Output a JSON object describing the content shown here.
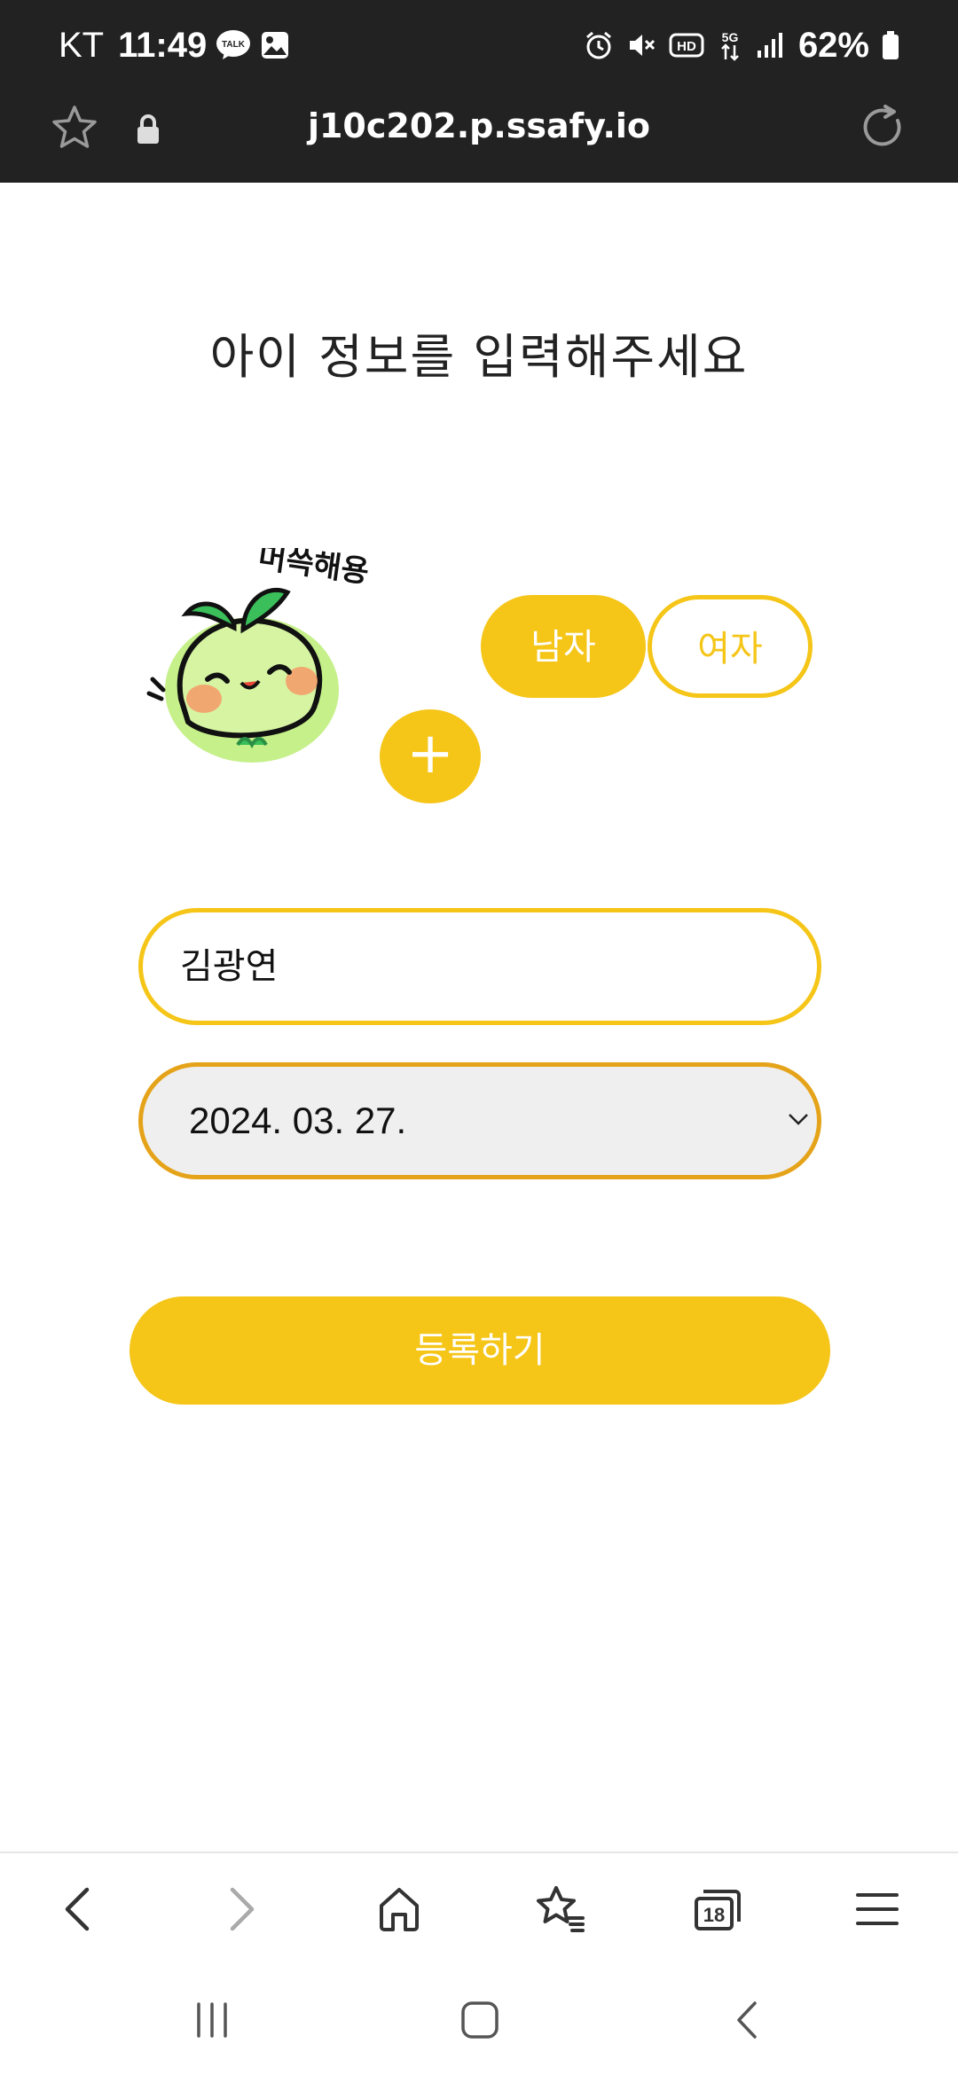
{
  "status_bar": {
    "carrier": "KT",
    "time": "11:49",
    "talk_label": "TALK",
    "hd_label": "HD",
    "network_label": "5G",
    "battery": "62%"
  },
  "browser": {
    "url": "j10c202.p.ssafy.io"
  },
  "form": {
    "title": "아이 정보를 입력해주세요",
    "gender": {
      "male": "남자",
      "female": "여자",
      "selected": "남자"
    },
    "add_photo_symbol": "+",
    "name_value": "김광연",
    "birth_date": "2024. 03. 27.",
    "submit_label": "등록하기"
  },
  "avatar": {
    "sticker_text": "머쓱해용"
  },
  "toolbar": {
    "tabs_count": "18"
  },
  "colors": {
    "accent": "#F5C518",
    "accent_dark": "#E5A31A",
    "bar_dark": "#222222",
    "field_bg": "#EFEFEF"
  }
}
